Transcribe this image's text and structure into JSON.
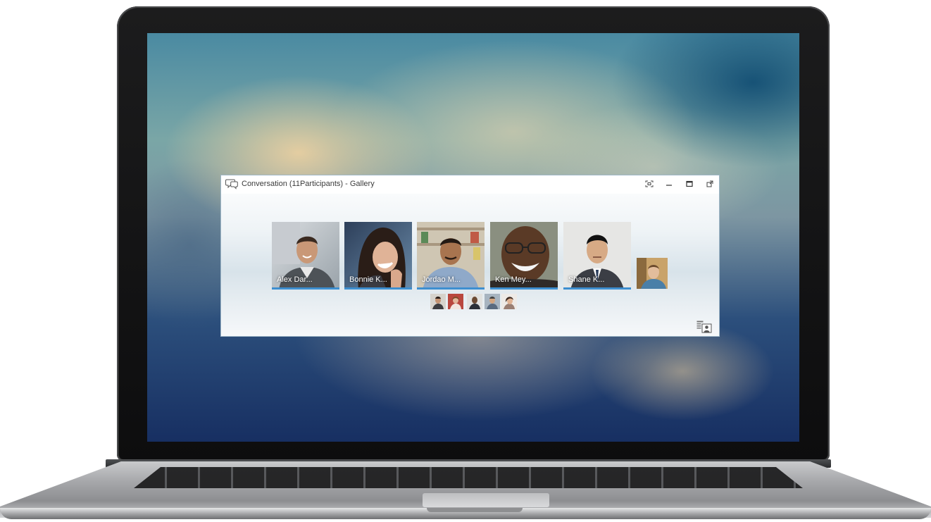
{
  "window": {
    "title": "Conversation (11Participants) - Gallery",
    "controls": {
      "fullscreen_icon": "fullscreen-icon",
      "minimize_icon": "minimize-icon",
      "maximize_icon": "maximize-icon",
      "popout_icon": "popout-icon"
    }
  },
  "gallery": {
    "active_speakers": [
      {
        "name": "Alex Dar..."
      },
      {
        "name": "Bonnie K..."
      },
      {
        "name": "Jordao M..."
      },
      {
        "name": "Ken Mey..."
      },
      {
        "name": "Shane K..."
      }
    ],
    "self_view": "self-video-preview",
    "other_participants_count_shown": 5
  },
  "toolbar": {
    "roster_icon": "participant-list-icon"
  },
  "colors": {
    "accent": "#3e8fd0",
    "title_text": "#3b3b3b",
    "window_border": "#9fb7c8"
  }
}
